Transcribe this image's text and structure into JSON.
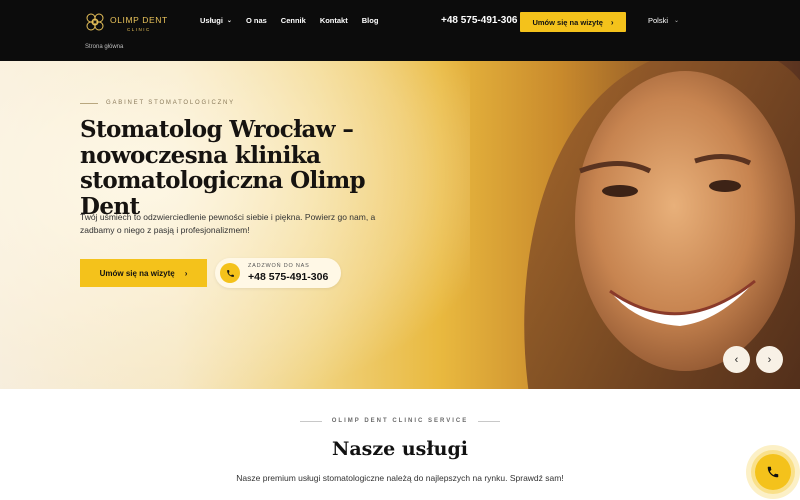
{
  "header": {
    "logo_name": "OLIMP DENT",
    "logo_sub": "CLINIC",
    "breadcrumb": "Strona główna",
    "nav": [
      {
        "label": "Usługi",
        "has_dropdown": true
      },
      {
        "label": "O nas"
      },
      {
        "label": "Cennik"
      },
      {
        "label": "Kontakt"
      },
      {
        "label": "Blog"
      }
    ],
    "phone": "+48 575-491-306",
    "cta_label": "Umów się na wizytę",
    "language": "Polski"
  },
  "hero": {
    "eyebrow": "GABINET STOMATOLOGICZNY",
    "title": "Stomatolog Wrocław – nowoczesna klinika stomatologiczna Olimp Dent",
    "description": "Twój uśmiech to odzwierciedlenie pewności siebie i piękna. Powierz go nam, a zadbamy o niego z pasją i profesjonalizmem!",
    "cta_label": "Umów się na wizytę",
    "call_label": "ZADZWOŃ DO NAS",
    "call_number": "+48 575-491-306"
  },
  "services": {
    "eyebrow": "OLIMP DENT CLINIC SERVICE",
    "title": "Nasze usługi",
    "description": "Nasze premium usługi stomatologiczne należą do najlepszych na rynku. Sprawdź sam!"
  },
  "colors": {
    "accent": "#f4c21b",
    "header_bg": "#0c0c0c",
    "logo_gold": "#e8c25a"
  },
  "icons": {
    "logo": "olimp-dent-logo-icon",
    "dropdown": "chevron-down-icon",
    "arrow": "chevron-right-icon",
    "phone": "phone-icon",
    "prev": "chevron-left-icon",
    "next": "chevron-right-icon"
  }
}
